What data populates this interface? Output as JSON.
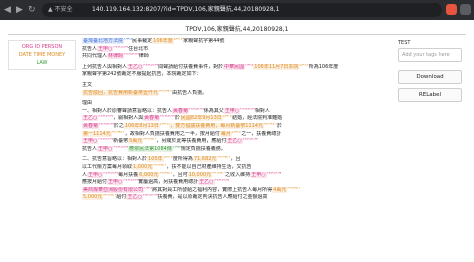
{
  "browser": {
    "back_icon": "arrow-left-icon",
    "forward_icon": "arrow-right-icon",
    "reload_icon": "reload-icon",
    "security_label": "▲ 不安全",
    "url": "140.119.164.132:8207/?id=TPDV,106,家親聲抗,44,20180928,1"
  },
  "document": {
    "title": "TPDV,106,家親聲抗,44,20180928,1"
  },
  "legend": {
    "items": [
      {
        "label": "ORG  ID  PERSON",
        "color": "#d93b8a"
      },
      {
        "label": "DATE  TIME  MONEY",
        "color": "#e08a1c"
      },
      {
        "label": "LAW",
        "color": "#3a9a3a"
      }
    ]
  },
  "content": {
    "lines": [
      [
        {
          "t": "臺灣臺北地方法院",
          "c": "#3a6fd8",
          "tag": "ORG"
        },
        {
          "t": "民事裁定"
        },
        {
          "t": "106年度",
          "c": "#e08a1c",
          "tag": "DATE"
        },
        {
          "t": "家親聲抗字第44號"
        }
      ],
      [
        {
          "t": "抗告人"
        },
        {
          "t": "王甲○",
          "c": "#d93b8a",
          "tag": "PERSON"
        },
        {
          "t": "住台北市"
        }
      ],
      [
        {
          "t": "共同代理人"
        },
        {
          "t": "林律師",
          "c": "#d93b8a",
          "tag": "PERSON"
        },
        {
          "t": "律師"
        }
      ],
      [],
      [
        {
          "t": "上列抗告人與相對人"
        },
        {
          "t": "王乙○",
          "c": "#d93b8a",
          "tag": "PERSON"
        },
        {
          "t": "間聲請給付扶養費事件，對於"
        },
        {
          "t": "中華民國",
          "c": "#d93b8a",
          "tag": "ORG"
        },
        {
          "t": "106年11月7日本院",
          "c": "#e08a1c",
          "tag": "DATE"
        },
        {
          "t": "所為106年度"
        }
      ],
      [
        {
          "t": "家親聲字第242號裁定不服提起抗告，本院裁定如下："
        }
      ],
      [],
      [
        {
          "t": "主文"
        }
      ],
      [
        {
          "t": "抗告駁回，抗告費用新臺幣壹仟元",
          "c": "#e08a1c",
          "tag": "MONEY"
        },
        {
          "t": "由抗告人負擔。"
        }
      ],
      [],
      [
        {
          "t": "理由"
        }
      ],
      [
        {
          "t": "一、相對人於原審聲請意旨略以：抗告人"
        },
        {
          "t": "黃春菊",
          "c": "#d93b8a",
          "tag": "PERSON"
        },
        {
          "t": "係為其父"
        },
        {
          "t": "王甲○",
          "c": "#d93b8a",
          "tag": "PERSON"
        },
        {
          "t": "相對人"
        }
      ],
      [
        {
          "t": "王乙○",
          "c": "#d93b8a",
          "tag": "PERSON"
        },
        {
          "t": "，嗣相對人與"
        },
        {
          "t": "黃春菊",
          "c": "#d93b8a",
          "tag": "PERSON"
        },
        {
          "t": "於"
        },
        {
          "t": "民國82年9月13日",
          "c": "#e08a1c",
          "tag": "DATE"
        },
        {
          "t": "結婚，經法院判准離婚"
        }
      ],
      [
        {
          "t": "黃春菊",
          "c": "#d93b8a",
          "tag": "PERSON"
        },
        {
          "t": "於之"
        },
        {
          "t": "106年8月13日",
          "c": "#e08a1c",
          "tag": "DATE"
        },
        {
          "t": "，雙方協議扶養費用，每月新臺幣1114元",
          "c": "#e08a1c",
          "tag": "MONEY"
        },
        {
          "t": "於"
        }
      ],
      [
        {
          "t": "第一1114元",
          "c": "#e08a1c",
          "tag": "MONEY"
        },
        {
          "t": "，故相對人負擔扶養費用之一半，按月給付"
        },
        {
          "t": "每月",
          "c": "#e08a1c",
          "tag": "DATE"
        },
        {
          "t": "之一，扶養費總計"
        }
      ],
      [
        {
          "t": "王甲○",
          "c": "#d93b8a",
          "tag": "PERSON"
        },
        {
          "t": "新臺幣"
        },
        {
          "t": "5萬元",
          "c": "#e08a1c",
          "tag": "MONEY"
        },
        {
          "t": "，另關於此等扶養費用，應給付"
        },
        {
          "t": "王乙○",
          "c": "#d93b8a",
          "tag": "PERSON"
        }
      ],
      [
        {
          "t": "抗告人"
        },
        {
          "t": "王甲○",
          "c": "#d93b8a",
          "tag": "PERSON"
        },
        {
          "t": "應依民法第1084條",
          "c": "#3a9a3a",
          "tag": "LAW"
        },
        {
          "t": "規定負擔扶養義務。"
        }
      ],
      [],
      [
        {
          "t": "二、抗告意旨略以：相對人於"
        },
        {
          "t": "105年",
          "c": "#e08a1c",
          "tag": "DATE"
        },
        {
          "t": "度所得為"
        },
        {
          "t": "71,682元",
          "c": "#e08a1c",
          "tag": "MONEY"
        },
        {
          "t": "，且"
        }
      ],
      [
        {
          "t": "以工代賑方案每月領取"
        },
        {
          "t": "1,000元",
          "c": "#e08a1c",
          "tag": "MONEY"
        },
        {
          "t": "，扶不能以自己財產維持生活，又抗告"
        }
      ],
      [
        {
          "t": "人"
        },
        {
          "t": "王甲○",
          "c": "#d93b8a",
          "tag": "PERSON"
        },
        {
          "t": "每月扶養"
        },
        {
          "t": "6,000元",
          "c": "#e08a1c",
          "tag": "MONEY"
        },
        {
          "t": "，且可"
        },
        {
          "t": "10,000元",
          "c": "#e08a1c",
          "tag": "MONEY"
        },
        {
          "t": "之收入維持"
        },
        {
          "t": "王甲○",
          "c": "#d93b8a",
          "tag": "PERSON"
        }
      ],
      [
        {
          "t": "應按月給付"
        },
        {
          "t": "王甲○",
          "c": "#d93b8a",
          "tag": "PERSON"
        },
        {
          "t": "實屬過高，另扶養費用總計"
        },
        {
          "t": "王乙○",
          "c": "#d93b8a",
          "tag": "PERSON"
        }
      ],
      [
        {
          "t": "美商燦華亞洲股份有限公司",
          "c": "#d93b8a",
          "tag": "ORG"
        },
        {
          "t": "將其對員工所發給之福利內容，實際上抗告人每月所得"
        },
        {
          "t": "4萬元",
          "c": "#e08a1c",
          "tag": "MONEY"
        }
      ],
      [
        {
          "t": "5,000元",
          "c": "#e08a1c",
          "tag": "MONEY"
        },
        {
          "t": "給付"
        },
        {
          "t": "王乙○",
          "c": "#d93b8a",
          "tag": "PERSON"
        },
        {
          "t": "扶養費，是以原裁定判決抗告人應給付之金額過高"
        }
      ]
    ]
  },
  "panel": {
    "section_label": "TEST",
    "tag_placeholder": "Add your tags here",
    "download_label": "Download",
    "relabel_label": "RELabel"
  },
  "colors": {
    "person": "#d93b8a",
    "org": "#3a6fd8",
    "date_money": "#e08a1c",
    "law": "#3a9a3a"
  }
}
